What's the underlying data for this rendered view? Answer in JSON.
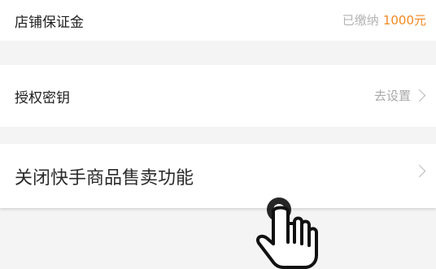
{
  "settings": {
    "deposit": {
      "label": "店铺保证金",
      "status": "已缴纳",
      "amount": "1000元",
      "accent_color": "#f08a22"
    },
    "authorization_key": {
      "label": "授权密钥",
      "action": "去设置"
    },
    "close_kuaishou_products": {
      "label": "关闭快手商品售卖功能"
    }
  },
  "icons": {
    "chevron": "chevron-right-icon",
    "pointer": "hand-pointer-icon"
  }
}
